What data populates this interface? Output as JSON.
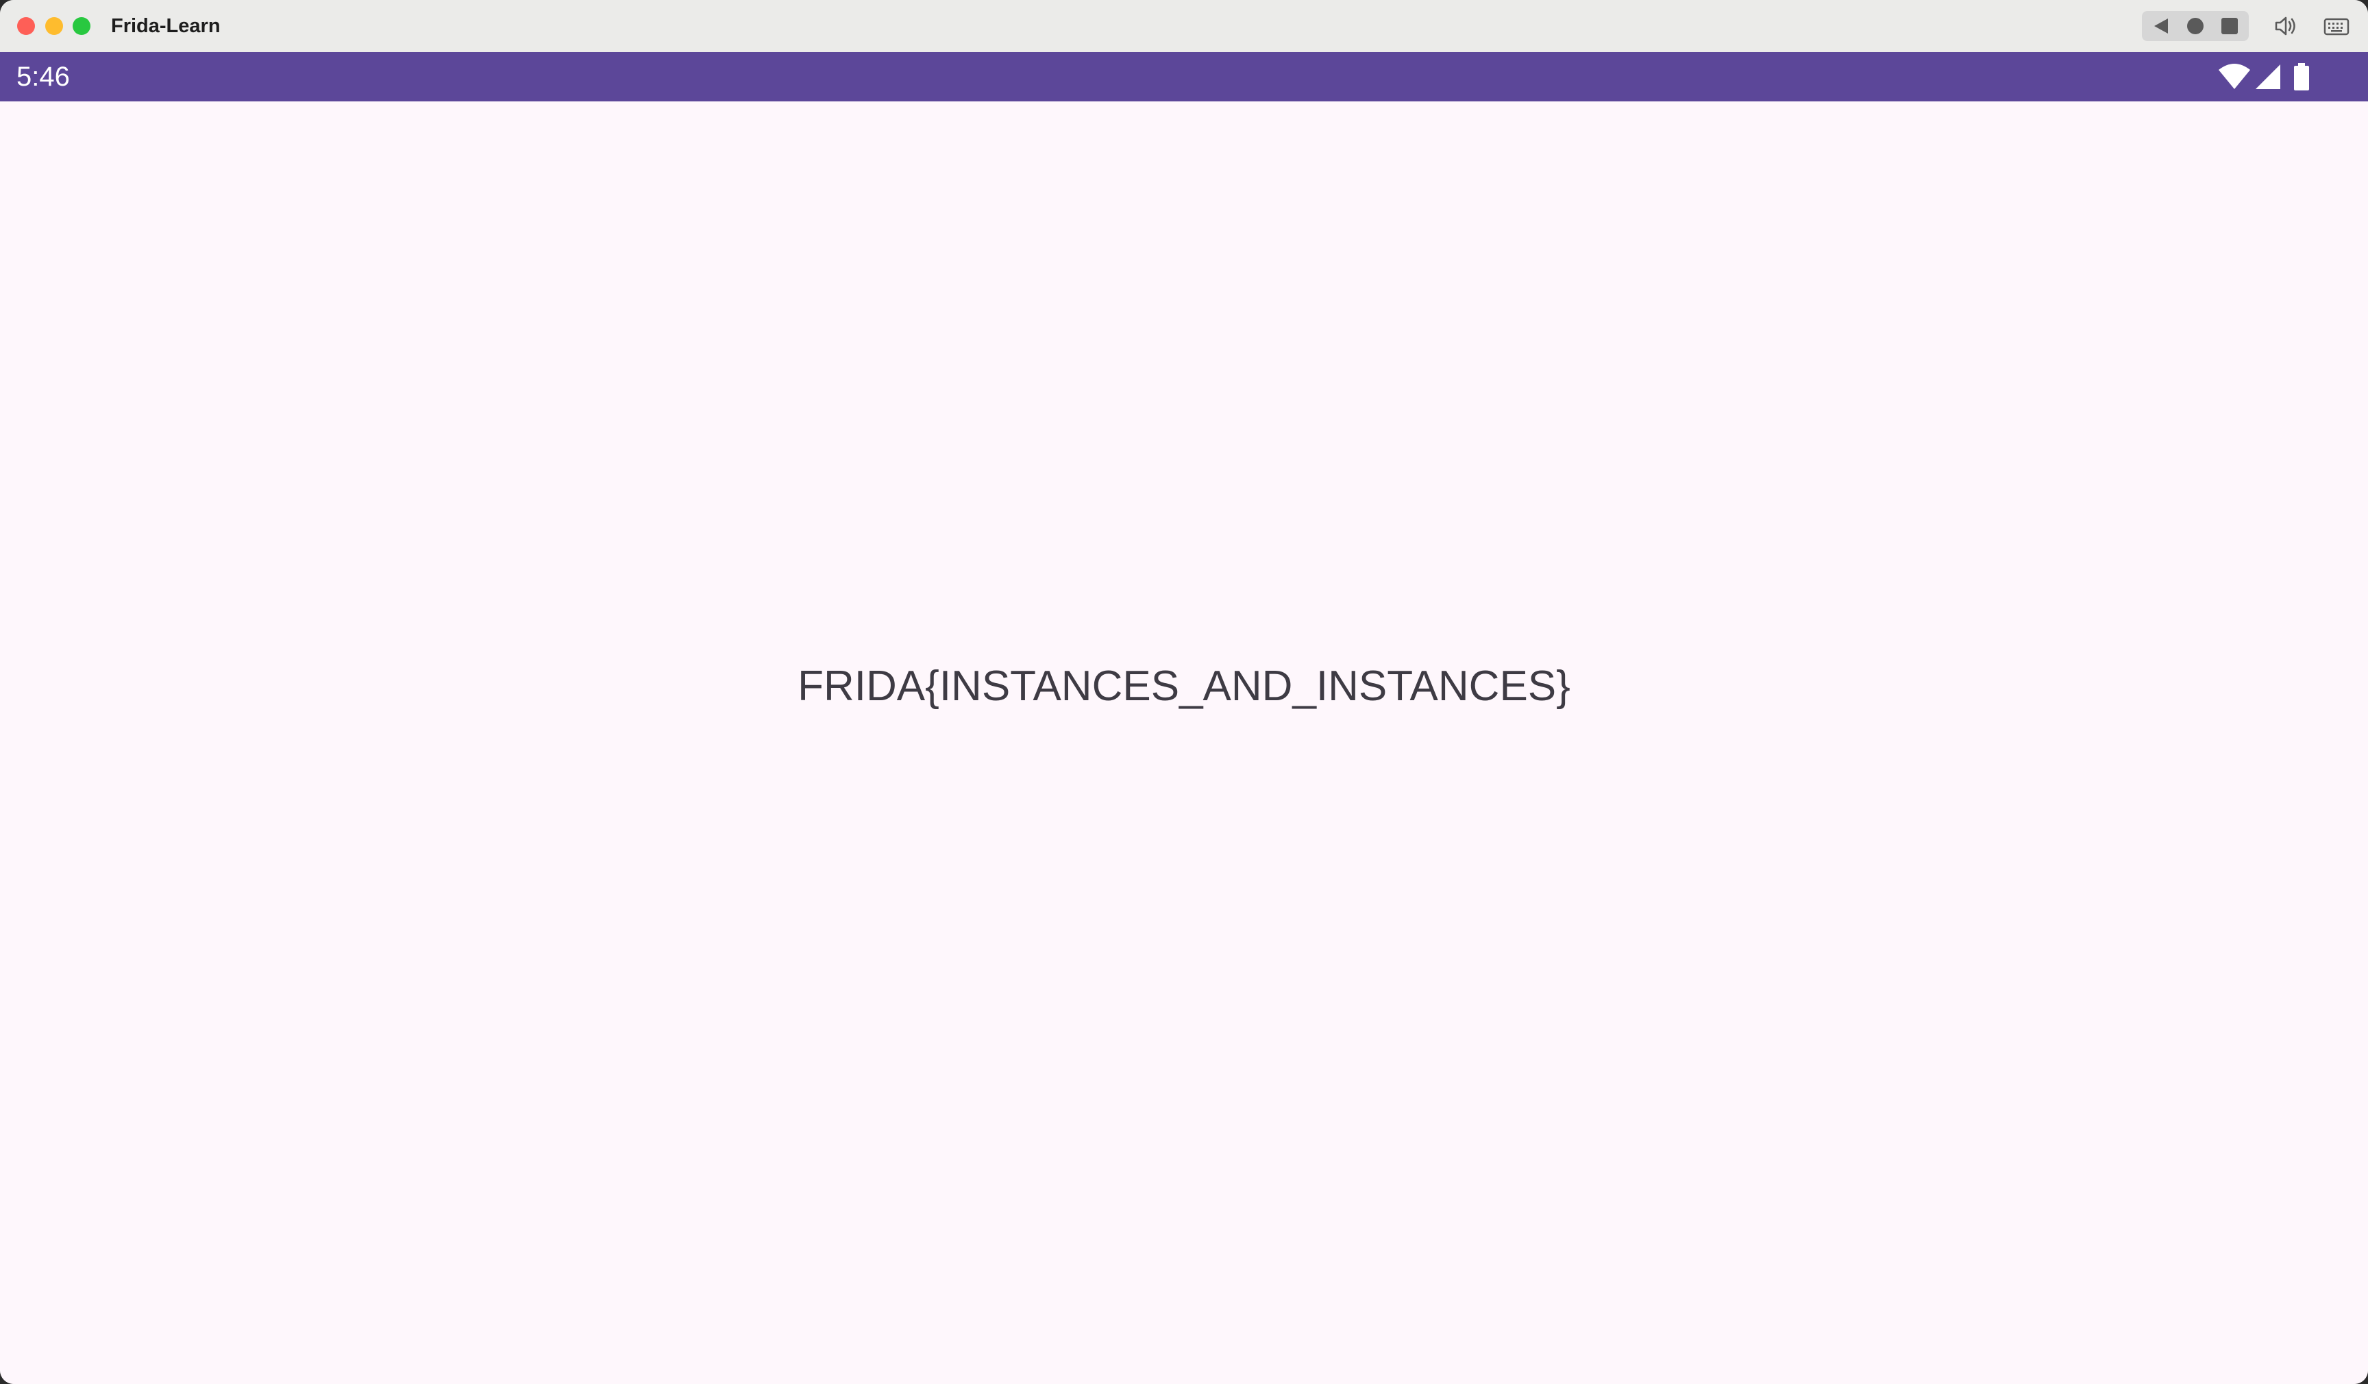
{
  "window": {
    "title": "Frida-Learn"
  },
  "titlebar": {
    "controls": [
      "close",
      "minimize",
      "maximize"
    ],
    "nav_buttons": [
      "back-icon",
      "home-icon",
      "recent-apps-icon"
    ],
    "tools": [
      "volume-icon",
      "keyboard-icon"
    ]
  },
  "status_bar": {
    "time": "5:46",
    "icons": [
      "wifi-icon",
      "cellular-signal-icon",
      "battery-icon"
    ],
    "background_color": "#5c4799"
  },
  "main": {
    "message": "FRIDA{INSTANCES_AND_INSTANCES}",
    "background_color": "#fef7fc"
  }
}
